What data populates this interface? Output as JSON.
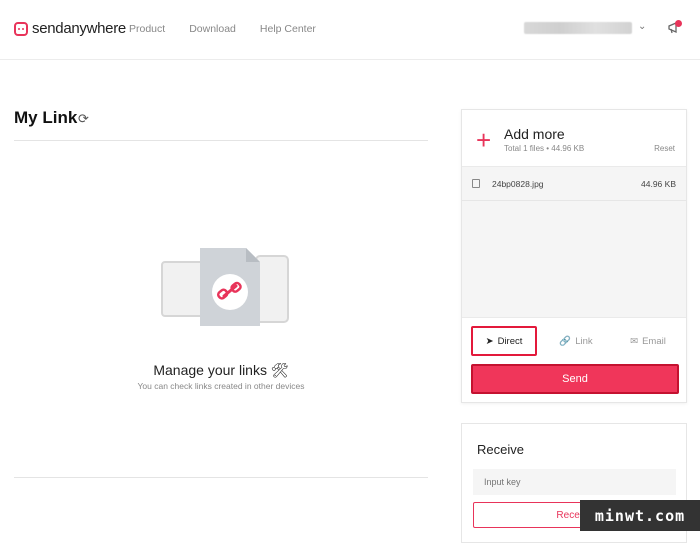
{
  "header": {
    "logo_text": "sendanywhere",
    "nav": [
      "Product",
      "Download",
      "Help Center"
    ],
    "chevron_icon": "chevron-down-icon",
    "notification_icon": "megaphone-icon"
  },
  "mylink": {
    "title": "My Link",
    "refresh_icon": "refresh-icon",
    "empty_title": "Manage your links 🛠",
    "empty_subtitle": "You can check links created in other devices"
  },
  "send_panel": {
    "add_more": "Add more",
    "total": "Total 1 files • 44.96 KB",
    "reset": "Reset",
    "files": [
      {
        "name": "24bp0828.jpg",
        "size": "44.96 KB",
        "icon": "image-icon"
      }
    ],
    "tabs": {
      "direct": "Direct",
      "link": "Link",
      "email": "Email"
    },
    "send_label": "Send"
  },
  "receive_panel": {
    "title": "Receive",
    "input_placeholder": "Input key",
    "button_label": "Receive"
  },
  "watermark": "minwt.com",
  "colors": {
    "accent": "#e8345a",
    "highlight_border": "#e3193b"
  }
}
